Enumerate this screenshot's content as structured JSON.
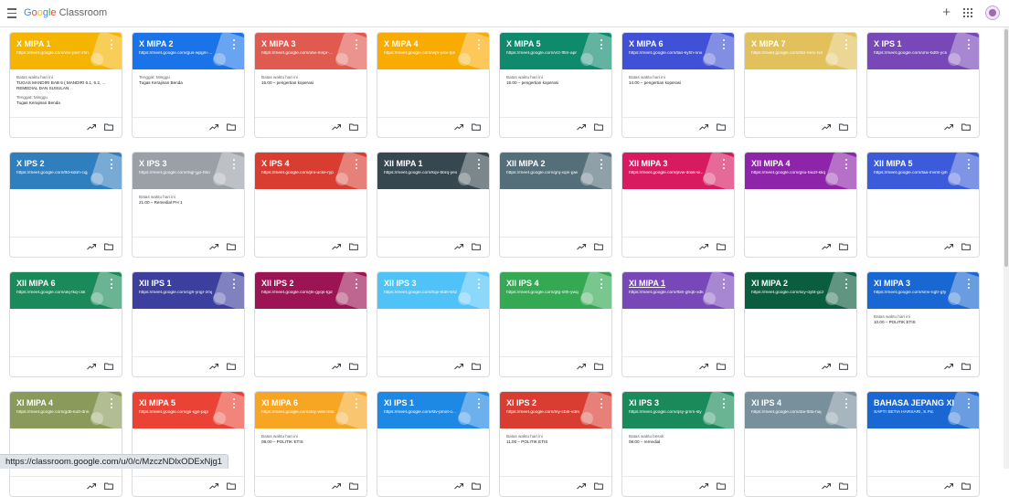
{
  "app": {
    "logo_google": [
      "G",
      "o",
      "o",
      "g",
      "l",
      "e"
    ],
    "logo_product": "Classroom"
  },
  "statusbar": {
    "url": "https://classroom.google.com/u/0/c/MzczNDlxODExNjg1"
  },
  "labels": {
    "due_today": "Batas waktu hari ini",
    "due_sunday": "Tenggat: Minggu",
    "due_tomorrow": "Batas waktu besok"
  },
  "colors": {
    "yellow": "#f4b400",
    "blue": "#1a73e8",
    "red": "#e05a4f",
    "orange": "#f9ab00",
    "teal": "#0f8a6c",
    "indigo": "#3f51d6",
    "khaki": "#e2c15a",
    "purple": "#7848b8",
    "steel": "#2f7fbf",
    "grey": "#9aa0a6",
    "crimson": "#d93c31",
    "slate": "#546e7a",
    "magenta": "#d81b60",
    "violet": "#8e24aa",
    "royal": "#3b5bdb",
    "green": "#1b8a5a",
    "navy": "#3c3f9e",
    "maroon": "#9c1453",
    "sky": "#4fc3f7",
    "leaf": "#34a853",
    "darkgreen": "#0b5d3f",
    "olive": "#8a9a5b",
    "coral": "#ea4335",
    "amber": "#f6a623",
    "azure": "#1e88e5",
    "bluegrey": "#78909c",
    "deepblue": "#1967d2"
  },
  "cards": [
    {
      "title": "X MIPA 1",
      "link": "https://meet.google.com/ww-pnrr-zhn",
      "color": "#f4b400",
      "items": [
        {
          "text": "Batas waktu hari ini",
          "label": true
        },
        {
          "text": "TUGAS MANDIRI BAB 6 ( MANDIRI 6.1, 6.2, ..."
        },
        {
          "text": "REMEDIAL DAN SUSULAN"
        },
        {
          "text": "Tenggat: Minggu",
          "label": true,
          "gap": true
        },
        {
          "text": "Tugas Kerajinan Benda"
        }
      ]
    },
    {
      "title": "X MIPA 2",
      "link": "https://meet.google.com/gus-wpgm-...",
      "color": "#1a73e8",
      "items": [
        {
          "text": "Tenggat: Minggu",
          "label": true
        },
        {
          "text": "Tugas Kerajinan Benda"
        }
      ]
    },
    {
      "title": "X MIPA 3",
      "link": "https://meet.google.com/utw-mnpr-...",
      "color": "#e05a4f",
      "items": [
        {
          "text": "Batas waktu hari ini",
          "label": true
        },
        {
          "text": "15.00 – pengertian koperasi"
        }
      ]
    },
    {
      "title": "X MIPA 4",
      "link": "https://meet.google.com/wpr-jvkv-tpk",
      "color": "#f9ab00",
      "items": []
    },
    {
      "title": "X MIPA 5",
      "link": "https://meet.google.com/vrz-fftm-apr",
      "color": "#0f8a6c",
      "items": [
        {
          "text": "Batas waktu hari ini",
          "label": true
        },
        {
          "text": "16.00 – pengertian koperasi"
        }
      ]
    },
    {
      "title": "X MIPA 6",
      "link": "https://meet.google.com/tan-kyhh-nnx",
      "color": "#3f51d6",
      "items": [
        {
          "text": "Batas waktu hari ini",
          "label": true
        },
        {
          "text": "14.00 – pengertian koperasi"
        }
      ]
    },
    {
      "title": "X MIPA 7",
      "link": "https://meet.google.com/hbr-mrci-rxz",
      "color": "#e2c15a",
      "items": []
    },
    {
      "title": "X IPS 1",
      "link": "https://meet.google.com/uhv-bdth-ycs",
      "color": "#7848b8",
      "items": []
    },
    {
      "title": "X IPS 2",
      "link": "https://meet.google.com/tfd-kdoh-cqj",
      "color": "#2f7fbf",
      "items": []
    },
    {
      "title": "X IPS 3",
      "link": "https://meet.google.com/mgr-jjjo-hho",
      "color": "#9aa0a6",
      "items": [
        {
          "text": "Batas waktu hari ini",
          "label": true
        },
        {
          "text": "21.00 – Remedial PH 1"
        }
      ]
    },
    {
      "title": "X IPS 4",
      "link": "https://meet.google.com/pni-ucke-ryp",
      "color": "#d93c31",
      "items": []
    },
    {
      "title": "XII MIPA 1",
      "link": "https://meet.google.com/kqv-bbrq-yex",
      "color": "#37474f",
      "items": []
    },
    {
      "title": "XII MIPA 2",
      "link": "https://meet.google.com/gnj-xqni-giw",
      "color": "#546e7a",
      "items": []
    },
    {
      "title": "XII MIPA 3",
      "link": "https://meet.google.com/pvw-dnxk-w...",
      "color": "#d81b60",
      "items": []
    },
    {
      "title": "XII MIPA 4",
      "link": "https://meet.google.com/gsu-fauzl-kkq",
      "color": "#8e24aa",
      "items": []
    },
    {
      "title": "XII MIPA 5",
      "link": "https://meet.google.com/taa-mvmt-gih",
      "color": "#3b5bdb",
      "items": []
    },
    {
      "title": "XII MIPA 6",
      "link": "https://meet.google.com/ukj-fkq-csk",
      "color": "#1b8a5a",
      "items": []
    },
    {
      "title": "XII IPS 1",
      "link": "https://meet.google.com/cgh-yngr-zmj",
      "color": "#3c3f9e",
      "items": []
    },
    {
      "title": "XII IPS 2",
      "link": "https://meet.google.com/jtn-gyqs-tgd",
      "color": "#9c1453",
      "items": []
    },
    {
      "title": "XII IPS 3",
      "link": "https://meet.google.com/hqx-ktdh-bsz",
      "color": "#4fc3f7",
      "items": []
    },
    {
      "title": "XII IPS 4",
      "link": "https://meet.google.com/gfg-sfth-ywq",
      "color": "#34a853",
      "items": []
    },
    {
      "title": "XI MIPA 1",
      "link": "https://meet.google.com/fbln-ghqb-xdk",
      "color": "#7848b8",
      "underline": true,
      "items": []
    },
    {
      "title": "XI MIPA 2",
      "link": "https://meet.google.com/sxy-oybt-gcz",
      "color": "#0b5d3f",
      "items": []
    },
    {
      "title": "XI MIPA 3",
      "link": "https://meet.google.com/smv-ngtr-gfy",
      "color": "#1967d2",
      "items": [
        {
          "text": "Batas waktu hari ini",
          "label": true
        },
        {
          "text": "10.00 – POLITIK ETIS"
        }
      ]
    },
    {
      "title": "XI MIPA 4",
      "link": "https://meet.google.com/gdb-kutt-dnn",
      "color": "#8a9a5b",
      "items": []
    },
    {
      "title": "XI MIPA 5",
      "link": "https://meet.google.com/jjn-qjjn-pqp",
      "color": "#ea4335",
      "items": []
    },
    {
      "title": "XI MIPA 6",
      "link": "https://meet.google.com/dsy-wsk-mtd",
      "color": "#f6a623",
      "items": [
        {
          "text": "Batas waktu hari ini",
          "label": true
        },
        {
          "text": "08.00 – POLITIK ETIS"
        }
      ]
    },
    {
      "title": "XI IPS 1",
      "link": "https://meet.google.com/stv-pmxt-o...",
      "color": "#1e88e5",
      "items": []
    },
    {
      "title": "XI IPS 2",
      "link": "https://meet.google.com/fny-cbih-vdm",
      "color": "#d93c31",
      "items": [
        {
          "text": "Batas waktu hari ini",
          "label": true
        },
        {
          "text": "11.00 – POLITIK ETIS"
        }
      ]
    },
    {
      "title": "XI IPS 3",
      "link": "https://meet.google.com/qsy-gmm-sly",
      "color": "#1b8a5a",
      "items": [
        {
          "text": "Batas waktu besok",
          "label": true
        },
        {
          "text": "08.00 – remedial"
        }
      ]
    },
    {
      "title": "XI IPS 4",
      "link": "https://meet.google.com/dai-fbfa-haj",
      "color": "#78909c",
      "items": []
    },
    {
      "title": "BAHASA JEPANG XI",
      "link": "SAPTI SETIA HARSARI, S.Pd.",
      "color": "#1967d2",
      "items": []
    }
  ]
}
